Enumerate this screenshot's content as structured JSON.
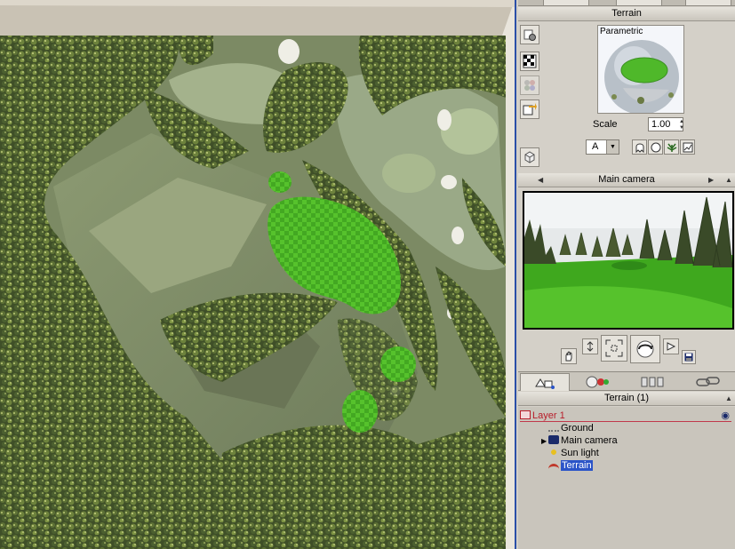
{
  "editor": {
    "object_panel": {
      "title": "Terrain",
      "material_preview_label": "Parametric",
      "scale_label": "Scale",
      "scale_value": "1.00",
      "mapping_mode": "A"
    },
    "camera_panel": {
      "title": "Main camera"
    },
    "world_browser": {
      "title": "Terrain (1)",
      "tree": {
        "layer": "Layer 1",
        "items": [
          "Ground",
          "Main camera",
          "Sun light",
          "Terrain"
        ],
        "selected": "Terrain"
      }
    }
  },
  "colors": {
    "accent_blue": "#2b54c8",
    "layer_red": "#b81d2a",
    "panel_gray": "#d4d0c8",
    "grass_green": "#4fb82a",
    "forest_dark": "#3c4a26"
  },
  "icons": [
    "gear-icon",
    "checker-icon",
    "palette-icon",
    "arrow-icon",
    "cube-icon",
    "hand-icon",
    "fit-icon",
    "orbit-icon",
    "play-icon",
    "save-icon",
    "eye-icon",
    "expand-arrow-icon"
  ]
}
